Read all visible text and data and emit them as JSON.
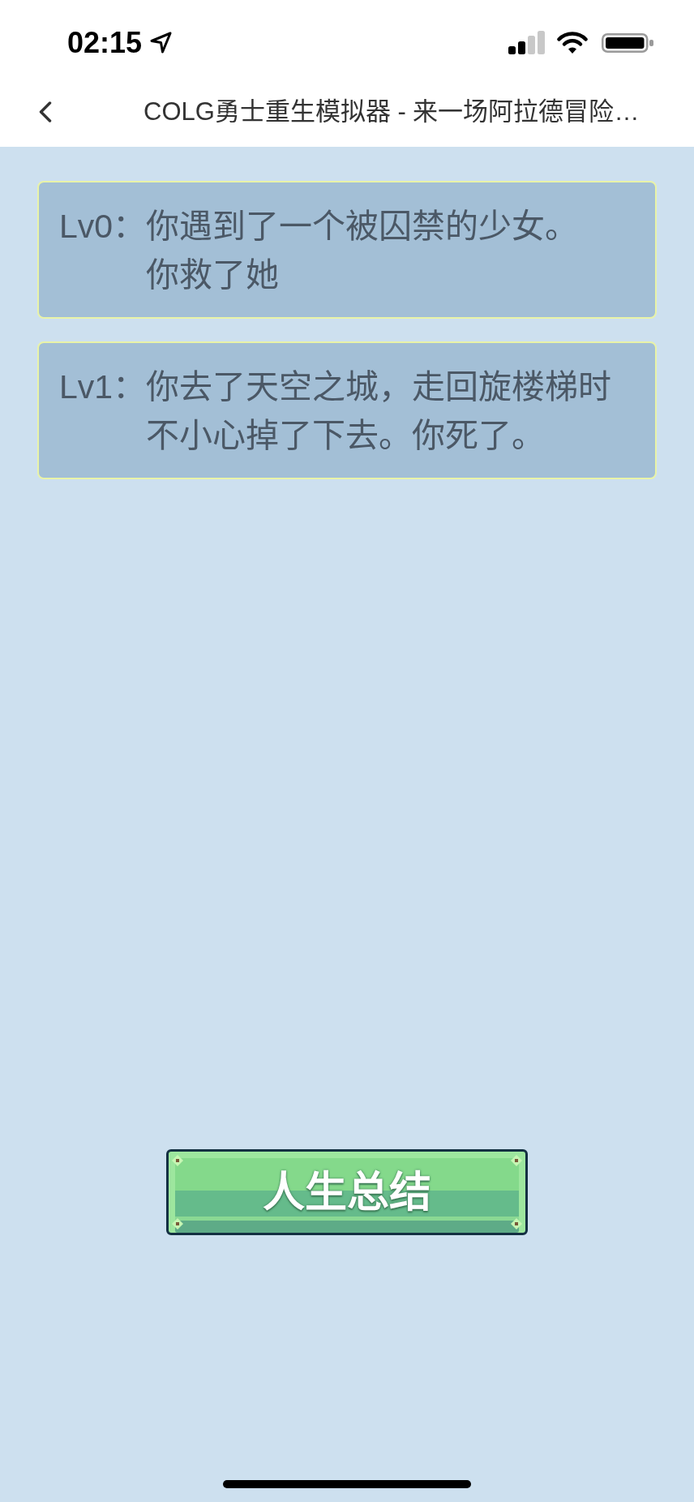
{
  "status_bar": {
    "time": "02:15"
  },
  "nav_bar": {
    "title": "COLG勇士重生模拟器 - 来一场阿拉德冒险…"
  },
  "events": [
    {
      "level": "Lv0：",
      "lines": [
        "你遇到了一个被囚禁的少女。",
        "你救了她"
      ]
    },
    {
      "level": "Lv1：",
      "lines": [
        "你去了天空之城，走回旋楼梯时不小心掉了下去。你死了。"
      ]
    }
  ],
  "buttons": [
    {
      "label": "人生总结"
    }
  ]
}
